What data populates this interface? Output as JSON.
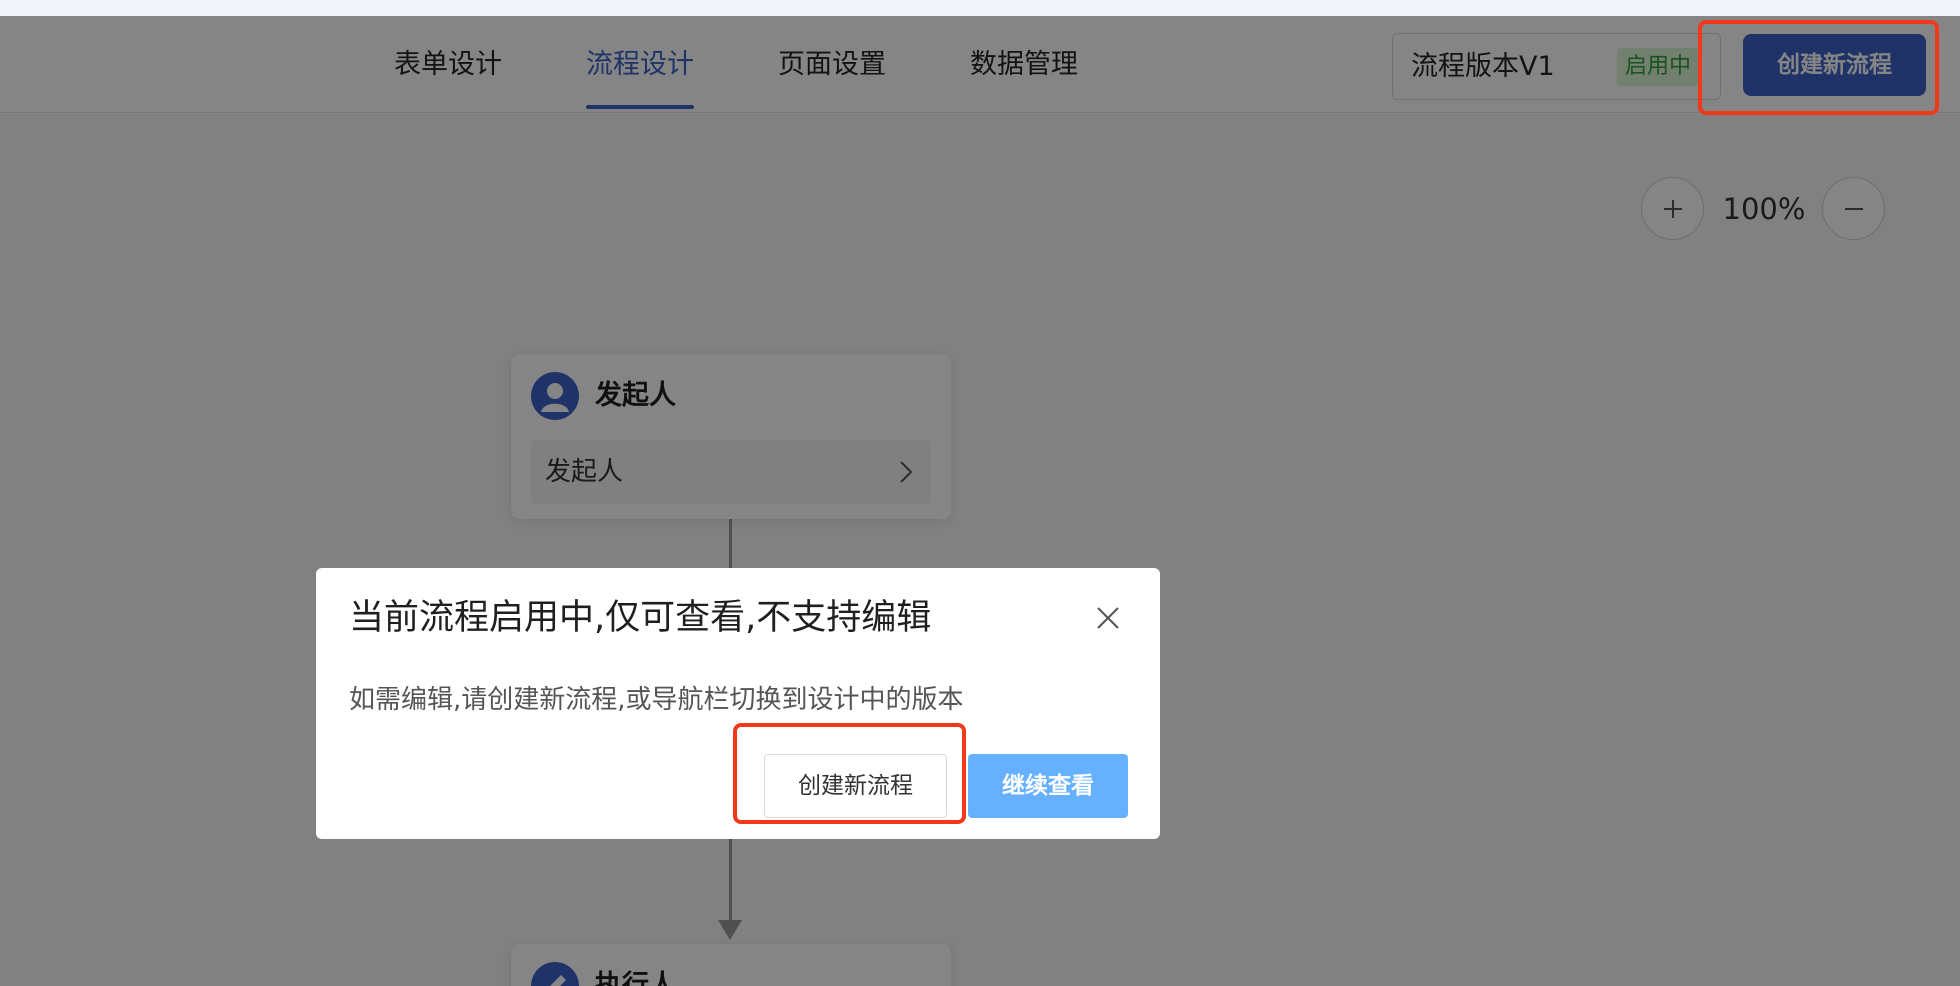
{
  "header": {
    "tabs": [
      {
        "label": "表单设计",
        "active": false
      },
      {
        "label": "流程设计",
        "active": true
      },
      {
        "label": "页面设置",
        "active": false
      },
      {
        "label": "数据管理",
        "active": false
      }
    ],
    "version_select": {
      "label": "流程版本V1",
      "status": "启用中"
    },
    "create_button": "创建新流程"
  },
  "canvas": {
    "zoom": {
      "level": "100%",
      "zoom_in_icon": "plus-icon",
      "zoom_out_icon": "minus-icon"
    },
    "nodes": [
      {
        "title": "发起人",
        "body": "发起人",
        "icon": "user-icon"
      },
      {
        "title": "执行人",
        "icon": "edit-icon"
      }
    ]
  },
  "modal": {
    "title": "当前流程启用中,仅可查看,不支持编辑",
    "message": "如需编辑,请创建新流程,或导航栏切换到设计中的版本",
    "create_button": "创建新流程",
    "continue_button": "继续查看",
    "close_icon": "close-icon"
  },
  "colors": {
    "primary": "#3c63c9",
    "continue_button": "#66b1ff",
    "status_badge_text": "#2e9f3c",
    "status_badge_bg": "#dcf5d7",
    "highlight": "#f0381a"
  }
}
